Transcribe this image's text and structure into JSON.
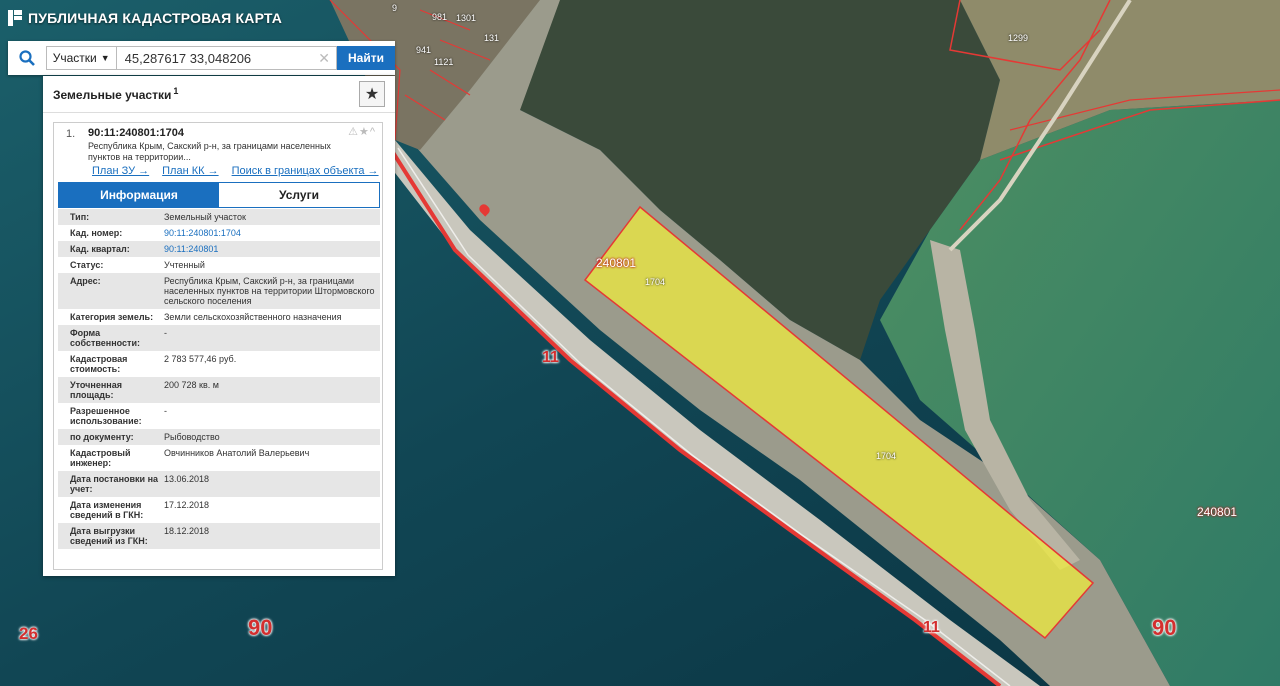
{
  "app": {
    "title": "ПУБЛИЧНАЯ КАДАСТРОВАЯ КАРТА"
  },
  "search": {
    "type_label": "Участки",
    "query": "45,287617 33,048206",
    "find_label": "Найти"
  },
  "panel": {
    "title": "Земельные участки",
    "count": "1",
    "result": {
      "index": "1.",
      "cad_number": "90:11:240801:1704",
      "address_short": "Республика Крым, Сакский р-н, за границами населенных пунктов на территории...",
      "links": [
        "План ЗУ →",
        "План КК →",
        "Поиск в границах объекта →"
      ],
      "tabs": [
        "Информация",
        "Услуги"
      ],
      "props": [
        {
          "label": "Тип:",
          "value": "Земельный участок"
        },
        {
          "label": "Кад. номер:",
          "value": "90:11:240801:1704"
        },
        {
          "label": "Кад. квартал:",
          "value": "90:11:240801"
        },
        {
          "label": "Статус:",
          "value": "Учтенный"
        },
        {
          "label": "Адрес:",
          "value": "Республика Крым, Сакский р-н, за границами населенных пунктов на территории Штормовского сельского поселения"
        },
        {
          "label": "Категория земель:",
          "value": "Земли сельскохозяйственного назначения"
        },
        {
          "label": "Форма собственности:",
          "value": "-"
        },
        {
          "label": "Кадастровая стоимость:",
          "value": "2 783 577,46 руб."
        },
        {
          "label": "Уточненная площадь:",
          "value": "200 728 кв. м"
        },
        {
          "label": "Разрешенное использование:",
          "value": "-"
        },
        {
          "label": "по документу:",
          "value": "Рыбоводство"
        },
        {
          "label": "Кадастровый инженер:",
          "value": "Овчинников Анатолий Валерьевич"
        },
        {
          "label": "Дата постановки на учет:",
          "value": "13.06.2018"
        },
        {
          "label": "Дата изменения сведений в ГКН:",
          "value": "17.12.2018"
        },
        {
          "label": "Дата выгрузки сведений из ГКН:",
          "value": "18.12.2018"
        }
      ]
    }
  },
  "map": {
    "labels": [
      {
        "name": "parcel-1704-label-top",
        "text": "1704"
      },
      {
        "name": "parcel-1704-label-center",
        "text": "1704"
      },
      {
        "name": "quarter-label-left",
        "text": "240801"
      },
      {
        "name": "quarter-label-right",
        "text": "240801"
      },
      {
        "name": "parcel-1299-label",
        "text": "1299"
      },
      {
        "name": "district-11-label-a",
        "text": "11"
      },
      {
        "name": "district-11-label-b",
        "text": "11"
      },
      {
        "name": "region-90-label-a",
        "text": "90"
      },
      {
        "name": "region-90-label-b",
        "text": "90"
      },
      {
        "name": "region-26-label",
        "text": "26"
      },
      {
        "name": "house-label-0",
        "text": "9"
      },
      {
        "name": "house-label-1",
        "text": "981"
      },
      {
        "name": "house-label-2",
        "text": "941"
      },
      {
        "name": "house-label-3",
        "text": "1121"
      },
      {
        "name": "house-label-4",
        "text": "131"
      },
      {
        "name": "house-label-5",
        "text": "1301"
      }
    ]
  },
  "colors": {
    "accent": "#1a6fbf",
    "boundary": "#e53935",
    "parcel_fill": "#f2ee3a"
  }
}
